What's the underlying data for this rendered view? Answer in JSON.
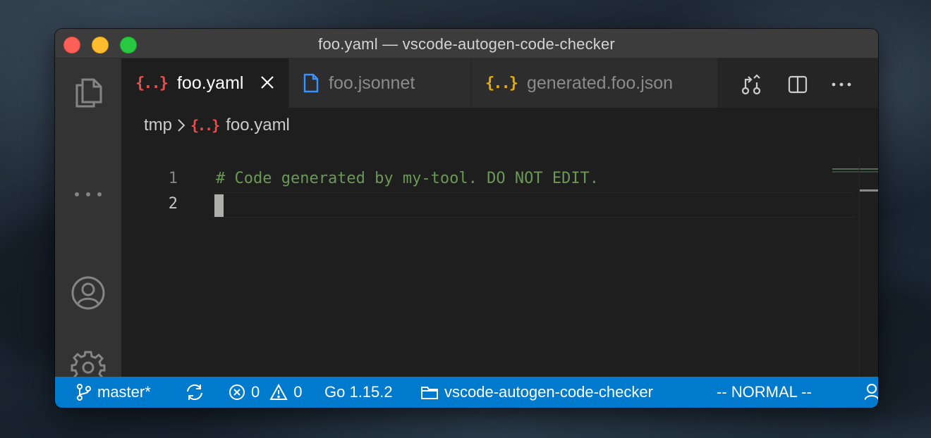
{
  "window": {
    "title": "foo.yaml — vscode-autogen-code-checker"
  },
  "activity_bar": {
    "icons": [
      "files-icon",
      "more-icon",
      "account-icon",
      "settings-gear-icon"
    ]
  },
  "tabs": [
    {
      "label": "foo.yaml",
      "icon": "json-braces-icon",
      "active": true,
      "icon_color": "#f14c4c"
    },
    {
      "label": "foo.jsonnet",
      "icon": "file-icon",
      "active": false,
      "icon_color": "#3794ff"
    },
    {
      "label": "generated.foo.json",
      "icon": "json-braces-icon",
      "active": false,
      "icon_color": "#e8ab00"
    }
  ],
  "tab_icon_text": "{..}",
  "editor_actions": [
    "open-changes-icon",
    "split-editor-icon",
    "more-actions-icon"
  ],
  "breadcrumb": {
    "folder": "tmp",
    "file": "foo.yaml"
  },
  "code": {
    "lines": [
      {
        "number": "1",
        "text": "# Code generated by my-tool. DO NOT EDIT."
      },
      {
        "number": "2",
        "text": ""
      }
    ]
  },
  "status_bar": {
    "branch": "master*",
    "errors": "0",
    "warnings": "0",
    "go_version": "Go 1.15.2",
    "workspace": "vscode-autogen-code-checker",
    "mode": "-- NORMAL --"
  },
  "colors": {
    "status_bar": "#007acc",
    "comment": "#6a9955",
    "active_tab_icon": "#f14c4c"
  }
}
